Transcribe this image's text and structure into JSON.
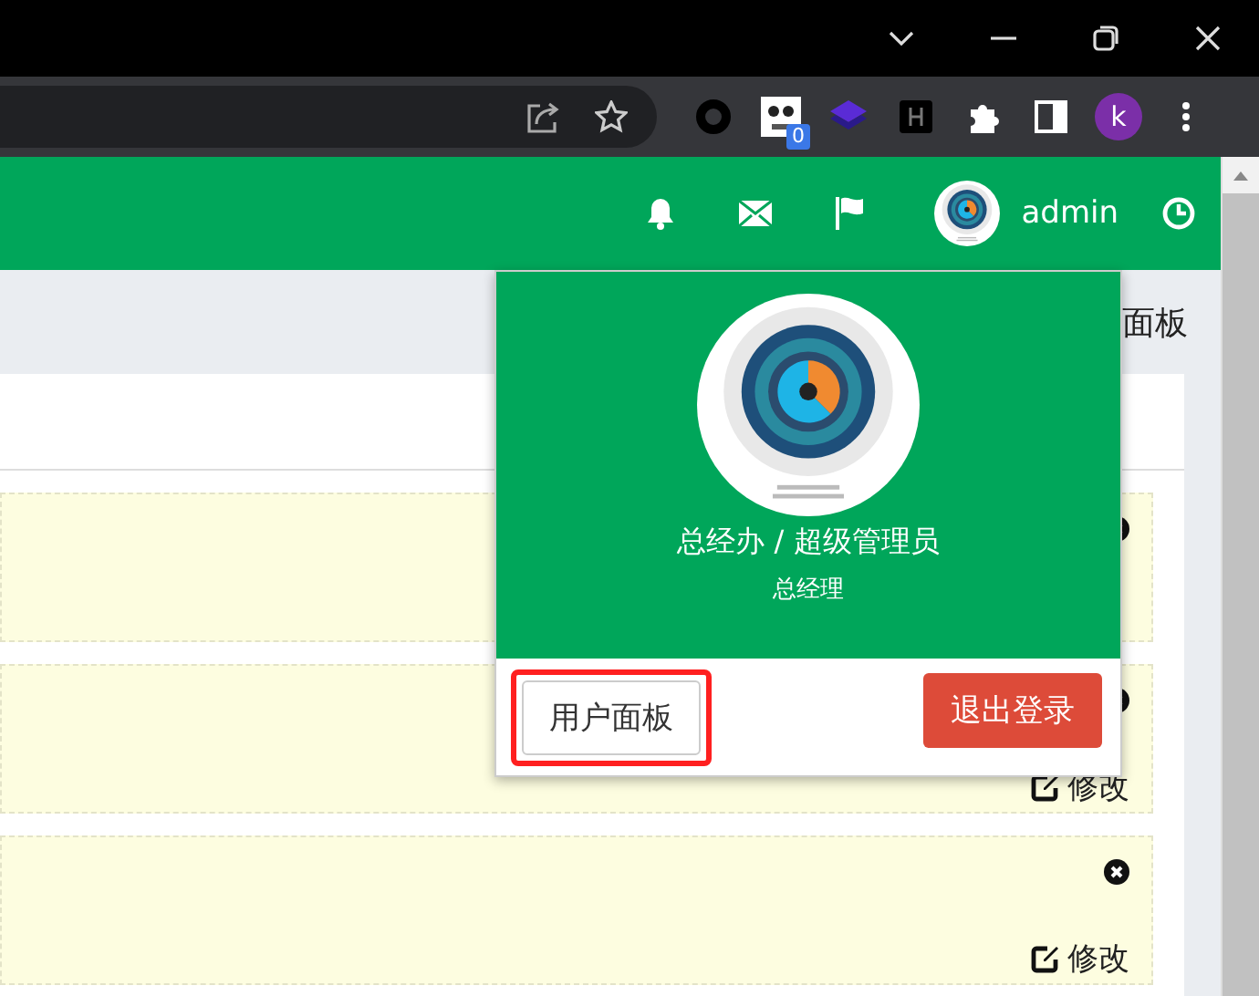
{
  "browser": {
    "profile_initial": "k",
    "extension_badge": "0"
  },
  "header": {
    "username": "admin"
  },
  "breadcrumb": "面板",
  "cards": [
    {
      "kind": "covered"
    },
    {
      "kind": "editable",
      "edit_label": "修改"
    },
    {
      "kind": "editable",
      "edit_label": "修改"
    }
  ],
  "user_popup": {
    "department_role": "总经办 / 超级管理员",
    "position": "总经理",
    "panel_button": "用户面板",
    "panel_button_highlighted": true,
    "logout_button": "退出登录"
  }
}
